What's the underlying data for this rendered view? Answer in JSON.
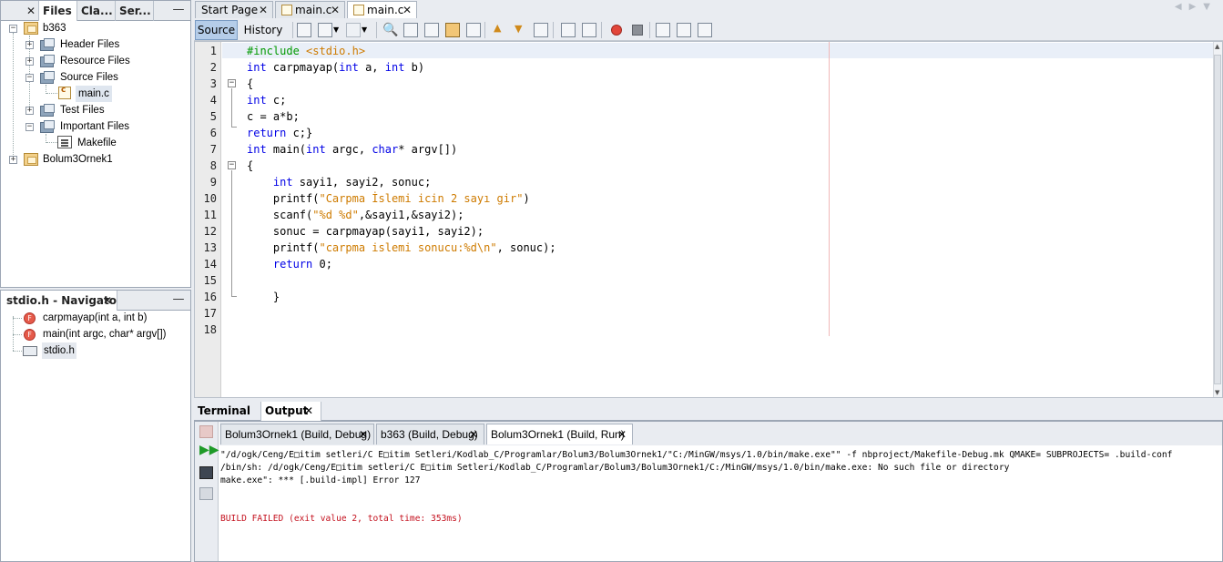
{
  "projects": {
    "tabs": [
      {
        "label": "Files"
      },
      {
        "label": "Cla..."
      },
      {
        "label": "Ser..."
      }
    ],
    "close_glyph": "✕",
    "minimize_glyph": "—",
    "tree": {
      "root": "b363",
      "children": [
        {
          "label": "Header Files"
        },
        {
          "label": "Resource Files"
        },
        {
          "label": "Source Files"
        },
        {
          "label": "main.c"
        },
        {
          "label": "Test Files"
        },
        {
          "label": "Important Files"
        },
        {
          "label": "Makefile"
        }
      ],
      "second_project": "Bolum3Ornek1"
    }
  },
  "navigator": {
    "title": "stdio.h - Navigator",
    "items": [
      {
        "label": "carpmayap(int a, int b)"
      },
      {
        "label": "main(int argc, char* argv[])"
      },
      {
        "label": "stdio.h"
      }
    ]
  },
  "editor": {
    "tabs": [
      {
        "label": "Start Page"
      },
      {
        "label": "main.c"
      },
      {
        "label": "main.c"
      }
    ],
    "toolbar": {
      "source_label": "Source",
      "history_label": "History"
    },
    "line_numbers": [
      "1",
      "2",
      "3",
      "4",
      "5",
      "6",
      "7",
      "8",
      "9",
      "10",
      "11",
      "12",
      "13",
      "14",
      "15",
      "16",
      "17",
      "18"
    ],
    "code": {
      "l1_pre": "#include ",
      "l1_inc": "<stdio.h>",
      "l2_kw1": "int",
      "l2_a": " carpmayap(",
      "l2_kw2": "int",
      "l2_b": " a, ",
      "l2_kw3": "int",
      "l2_c": " b)",
      "l3": "{",
      "l4_kw": "int",
      "l4_rest": " c;",
      "l5": "c = a*b;",
      "l6_kw": "return",
      "l6_rest": " c;}",
      "l7_kw1": "int",
      "l7_a": " main(",
      "l7_kw2": "int",
      "l7_b": " argc, ",
      "l7_kw3": "char",
      "l7_c": "* argv[])",
      "l8": "{",
      "l9_kw": "    int",
      "l9_rest": " sayi1, sayi2, sonuc;",
      "l10_a": "    printf(",
      "l10_str": "\"Carpma İslemi icin 2 sayı gir\"",
      "l10_b": ")",
      "l11_a": "    scanf(",
      "l11_str": "\"%d %d\"",
      "l11_b": ",&sayi1,&sayi2);",
      "l12": "    sonuc = carpmayap(sayi1, sayi2);",
      "l13_a": "    printf(",
      "l13_str": "\"carpma islemi sonucu:%d\\n\"",
      "l13_b": ", sonuc);",
      "l14_kw": "    return",
      "l14_rest": " 0;",
      "l16": "    }"
    }
  },
  "output": {
    "tabs": [
      {
        "label": "Terminal"
      },
      {
        "label": "Output"
      }
    ],
    "run_tabs": [
      {
        "label": "Bolum3Ornek1 (Build, Debug)"
      },
      {
        "label": "b363 (Build, Debug)"
      },
      {
        "label": "Bolum3Ornek1 (Build, Run)"
      }
    ],
    "lines": [
      "\"/d/ogk/Ceng/E□itim setleri/C E□itim Setleri/Kodlab_C/Programlar/Bolum3/Bolum3Ornek1/\"C:/MinGW/msys/1.0/bin/make.exe\"\" -f nbproject/Makefile-Debug.mk QMAKE= SUBPROJECTS= .build-conf",
      "/bin/sh: /d/ogk/Ceng/E□itim setleri/C E□itim Setleri/Kodlab_C/Programlar/Bolum3/Bolum3Ornek1/C:/MinGW/msys/1.0/bin/make.exe: No such file or directory",
      "make.exe\": *** [.build-impl] Error 127"
    ],
    "build_failed": "BUILD FAILED (exit value 2, total time: 353ms)"
  }
}
